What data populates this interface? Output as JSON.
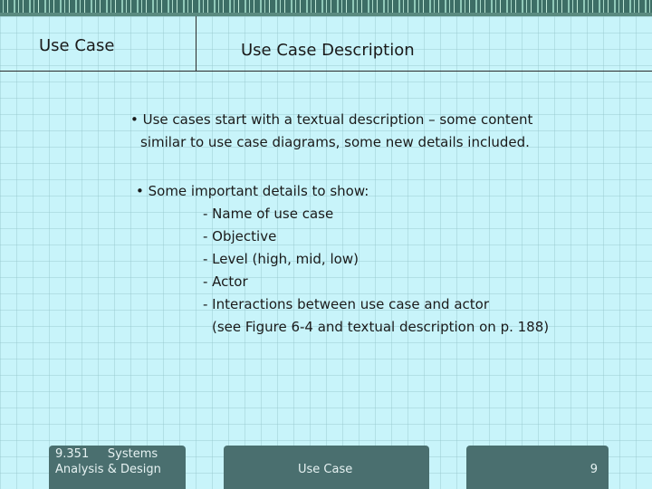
{
  "header": {
    "left_label": "Use Case",
    "title": "Use Case Description"
  },
  "content": {
    "bullet1_line1": "• Use cases start with a textual description – some content",
    "bullet1_line2": "similar to use case diagrams, some new details included.",
    "bullet2": "• Some important details to show:",
    "details": [
      "- Name of use case",
      "- Objective",
      "- Level (high, mid, low)",
      "- Actor",
      "- Interactions between use case and actor"
    ],
    "reference": "(see Figure 6-4 and textual description on p. 188)"
  },
  "footer": {
    "course_line1": "9.351     Systems",
    "course_line2": "Analysis & Design",
    "center": "Use Case",
    "page_number": "9"
  },
  "colors": {
    "background": "#c8f4fa",
    "footer": "#4a6f6f",
    "top_strip": "#3d6e66"
  }
}
